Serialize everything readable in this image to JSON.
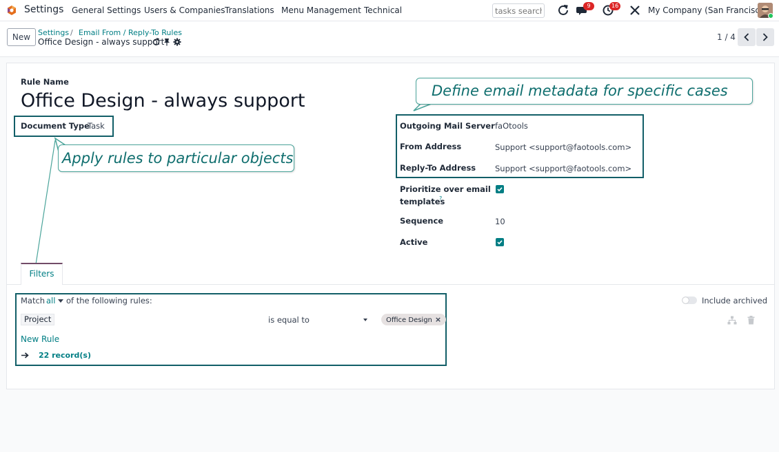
{
  "navbar": {
    "app_title": "Settings",
    "menu": [
      "General Settings",
      "Users & Companies",
      "Translations",
      "Menu Management",
      "Technical"
    ],
    "search_placeholder": "tasks search",
    "messages_badge": "9",
    "activities_badge": "16",
    "company": "My Company (San Francisco)"
  },
  "control": {
    "new_button": "New",
    "breadcrumb": [
      "Settings",
      "Email From / Reply-To Rules"
    ],
    "breadcrumb_sep": "/",
    "record_title": "Office Design - always support",
    "pager": "1 / 4"
  },
  "form": {
    "rule_name_label": "Rule Name",
    "rule_name": "Office Design - always support",
    "document_type_label": "Document Type",
    "document_type": "Task",
    "outgoing_server_label": "Outgoing Mail Server",
    "outgoing_server": "faOtools",
    "from_label": "From Address",
    "from_value": "Support <support@faotools.com>",
    "reply_to_label": "Reply-To Address",
    "reply_to_value": "Support <support@faotools.com>",
    "prioritize_label_1": "Prioritize over email",
    "prioritize_label_2": "templates",
    "prioritize_help": "?",
    "prioritize_checked": true,
    "sequence_label": "Sequence",
    "sequence": "10",
    "active_label": "Active",
    "active_checked": true
  },
  "callouts": {
    "metadata": "Define email metadata for specific cases",
    "objects": "Apply rules to particular objects"
  },
  "filters": {
    "tab_label": "Filters",
    "match_prefix": "Match",
    "match_mode": "all",
    "match_suffix": "of the following rules:",
    "include_archived": "Include archived",
    "rule_field": "Project",
    "rule_operator": "is equal to",
    "rule_value": "Office Design",
    "new_rule": "New Rule",
    "records": "22 record(s)"
  },
  "colors": {
    "accent": "#017e84",
    "annotation": "#115e67",
    "badge": "#dc2626"
  }
}
